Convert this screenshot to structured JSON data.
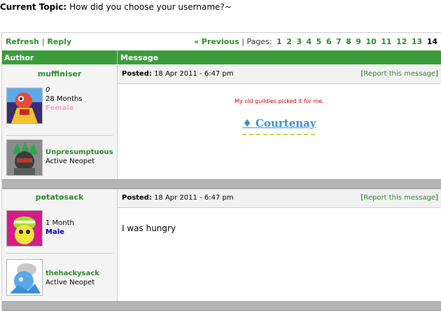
{
  "topic": {
    "label": "Current Topic:",
    "title": "How did you choose your username?~"
  },
  "nav": {
    "refresh": "Refresh",
    "separator": "|",
    "reply": "Reply",
    "previous": "« Previous",
    "pages_label": "| Pages:",
    "pages": [
      "1",
      "2",
      "3",
      "4",
      "5",
      "6",
      "7",
      "8",
      "9",
      "10",
      "11",
      "12",
      "13",
      "14"
    ],
    "current_page": "14"
  },
  "columns": {
    "author": "Author",
    "message": "Message"
  },
  "posts": [
    {
      "username": "muffiniser",
      "stat1": "0",
      "age": "28 Months",
      "gender": "Female",
      "pet_name": "Unpresumptuous",
      "pet_status": "Active Neopet",
      "posted_label": "Posted:",
      "posted_date": "18 Apr 2011 - 6:47 pm",
      "report": "Report this message",
      "message": "My old guildies picked it for me.",
      "signature": "♦ Courtenay"
    },
    {
      "username": "potatosack",
      "age": "1 Month",
      "gender": "Male",
      "pet_name": "thehackysack",
      "pet_status": "Active Neopet",
      "posted_label": "Posted:",
      "posted_date": "18 Apr 2011 - 6:47 pm",
      "report": "Report this message",
      "message": "I was hungry"
    }
  ],
  "colors": {
    "green": "#2d8a2d",
    "header": "#3c9c3c",
    "female": "#ffa6c9",
    "male": "#0000cc",
    "message_red": "#cc0000",
    "signature_blue": "#3a8fd6"
  }
}
